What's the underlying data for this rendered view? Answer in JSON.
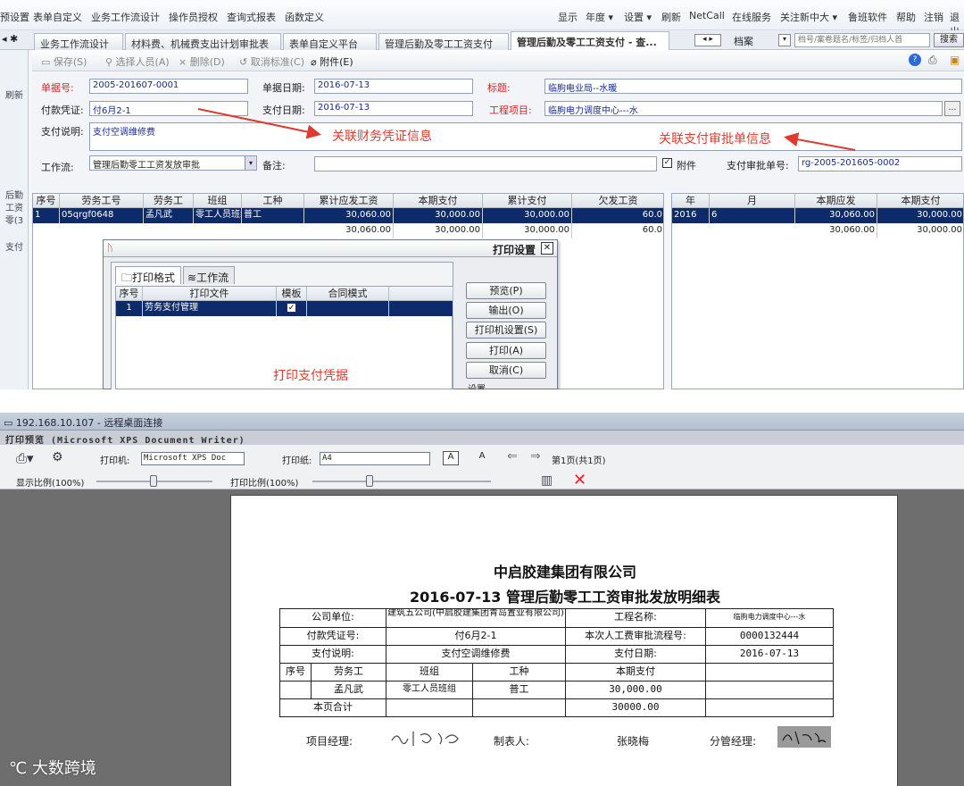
{
  "menu": {
    "left": [
      "预设置",
      "表单自定义",
      "业务工作流设计",
      "操作员授权",
      "查询式报表",
      "函数定义"
    ],
    "right": [
      "显示",
      "年度 ▾",
      "设置 ▾",
      "刷新",
      "NetCall",
      "在线服务",
      "关注新中大 ▾",
      "鲁班软件",
      "帮助",
      "注销",
      "退出"
    ]
  },
  "tabs": [
    "业务工作流设计",
    "材料费、机械费支出计划审批表",
    "表单自定义平台",
    "管理后勤及零工工资支付",
    "管理后勤及零工工资支付 - 查...",
    "档案"
  ],
  "search": {
    "placeholder": "档号/案卷题名/标签/归档人首",
    "button": "搜索"
  },
  "left_strip": [
    "刷新",
    "后勤",
    "工资",
    "零(3",
    "支付"
  ],
  "toolbar": {
    "save": "保存(S)",
    "select": "选择人员(A)",
    "delete": "删除(D)",
    "cancel": "取消标准(C)",
    "attach": "附件(E)"
  },
  "form": {
    "doc_no_label": "单据号:",
    "doc_no": "2005-201607-0001",
    "doc_date_label": "单据日期:",
    "doc_date": "2016-07-13",
    "title_label": "标题:",
    "title": "临朐电业局--水暖",
    "voucher_label": "付款凭证:",
    "voucher": "付6月2-1",
    "pay_date_label": "支付日期:",
    "pay_date": "2016-07-13",
    "project_label": "工程项目:",
    "project": "临朐电力调度中心---水",
    "desc_label": "支付说明:",
    "desc": "支付空调维修费",
    "workflow_label": "工作流:",
    "workflow": "管理后勤零工工资发放审批",
    "remark_label": "备注:",
    "remark": "",
    "attach_label": "附件",
    "approval_label": "支付审批单号:",
    "approval_no": "rg-2005-201605-0002"
  },
  "notes": {
    "voucher_note": "关联财务凭证信息",
    "approval_note": "关联支付审批单信息",
    "print_note": "打印支付凭据"
  },
  "left_grid": {
    "columns": [
      "序号",
      "劳务工号",
      "劳务工",
      "班组",
      "工种",
      "累计应发工资",
      "本期支付",
      "累计支付",
      "欠发工资"
    ],
    "row": [
      "1",
      "05qrgf0648",
      "孟凡武",
      "零工人员班组",
      "普工",
      "30,060.00",
      "30,000.00",
      "30,000.00",
      "60.0"
    ],
    "total": [
      "",
      "",
      "",
      "",
      "",
      "30,060.00",
      "30,000.00",
      "30,000.00",
      "60.0"
    ]
  },
  "right_grid": {
    "columns": [
      "年",
      "月",
      "本期应发",
      "本期支付"
    ],
    "row": [
      "2016",
      "6",
      "30,060.00",
      "30,000.00"
    ],
    "total": [
      "",
      "",
      "30,060.00",
      "30,000.00"
    ]
  },
  "print_dialog": {
    "title": "打印设置",
    "tabs": [
      "打印格式",
      "工作流"
    ],
    "columns": [
      "序号",
      "打印文件",
      "模板",
      "合同模式"
    ],
    "row": [
      "1",
      "劳务支付管理",
      "",
      ""
    ],
    "buttons": [
      "预览(P)",
      "输出(O)",
      "打印机设置(S)",
      "打印(A)",
      "取消(C)"
    ],
    "section": "设置"
  },
  "rdp": {
    "title": "192.168.10.107 - 远程桌面连接",
    "preview_title": "打印预览 (Microsoft XPS Document Writer)",
    "printer_label": "打印机:",
    "printer": "Microsoft XPS Doc",
    "paper_label": "打印纸:",
    "paper": "A4",
    "page_info": "第1页(共1页)",
    "display_ratio": "显示比例(100%)",
    "print_ratio": "打印比例(100%)"
  },
  "document": {
    "company": "中启胶建集团有限公司",
    "title": "2016-07-13 管理后勤零工工资审批发放明细表",
    "unit_label": "公司单位:",
    "unit": "建筑五公司(中启胶建集团青岛置业有限公司)",
    "project_label": "工程名称:",
    "project": "临朐电力调度中心---水",
    "voucher_label": "付款凭证号:",
    "voucher": "付6月2-1",
    "flow_label": "本次人工费审批流程号:",
    "flow": "0000132444",
    "desc_label": "支付说明:",
    "desc": "支付空调维修费",
    "date_label": "支付日期:",
    "date": "2016-07-13",
    "col_no": "序号",
    "col_worker": "劳务工",
    "col_team": "班组",
    "col_type": "工种",
    "col_pay": "本期支付",
    "row_worker": "孟凡武",
    "row_team": "零工人员班组",
    "row_type": "普工",
    "row_pay": "30,000.00",
    "subtotal_label": "本页合计",
    "subtotal": "30000.00",
    "pm_label": "项目经理:",
    "maker_label": "制表人:",
    "maker": "张晓梅",
    "manager_label": "分管经理:"
  },
  "watermark": "大数跨境",
  "colors": {
    "accent": "#0d2a6a",
    "note_red": "#e03a2e",
    "label_red": "#d22222"
  }
}
